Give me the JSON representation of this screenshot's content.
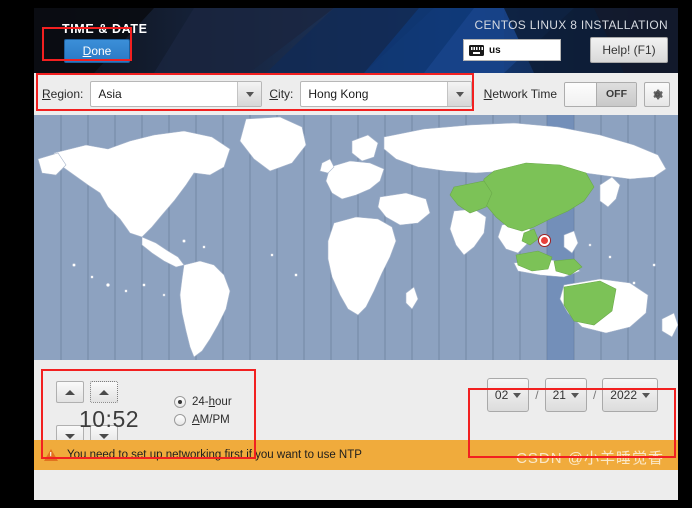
{
  "header": {
    "section_title": "TIME & DATE",
    "product_title": "CENTOS LINUX 8 INSTALLATION",
    "done_label": "Done",
    "done_mnemonic": "D",
    "done_rest": "one",
    "keyboard_layout": "us",
    "keyboard_icon": "keyboard-icon",
    "help_label": "Help! (F1)"
  },
  "toolbar": {
    "region_label_mnemonic": "R",
    "region_label_rest": "egion:",
    "region_value": "Asia",
    "city_label_mnemonic": "C",
    "city_label_rest": "ity:",
    "city_value": "Hong Kong",
    "network_time_mnemonic": "N",
    "network_time_rest": "etwork Time",
    "network_time_state": "OFF",
    "config_icon": "gear-icon"
  },
  "map": {
    "ocean_color": "#8da2c0",
    "land_color": "#ffffff",
    "highlight_color": "#7cc257",
    "timezone_line_color": "#7286a3",
    "pin_icon": "location-pin-icon",
    "pin_city": "Hong Kong"
  },
  "time": {
    "value": "10:52",
    "hour": "10",
    "minute": "52",
    "up_icon": "chevron-up-icon",
    "down_icon": "chevron-down-icon",
    "format_24_mnemonic": "24-",
    "format_24_label": "h",
    "format_24_rest": "our",
    "format_24_selected": true,
    "format_ampm_mnemonic": "A",
    "format_ampm_rest": "M/PM",
    "format_ampm_selected": false
  },
  "date": {
    "month": "02",
    "day": "21",
    "year": "2022",
    "separator": "/"
  },
  "warning": {
    "icon": "warning-triangle-icon",
    "message": "You need to set up networking first if you want to use NTP"
  },
  "watermark": {
    "text": "CSDN @小羊睡觉香"
  },
  "annotations": {
    "accent_color": "#f22020",
    "boxes": [
      {
        "name": "done-button-highlight"
      },
      {
        "name": "region-city-row-highlight"
      },
      {
        "name": "time-panel-highlight"
      },
      {
        "name": "date-panel-highlight"
      }
    ]
  }
}
